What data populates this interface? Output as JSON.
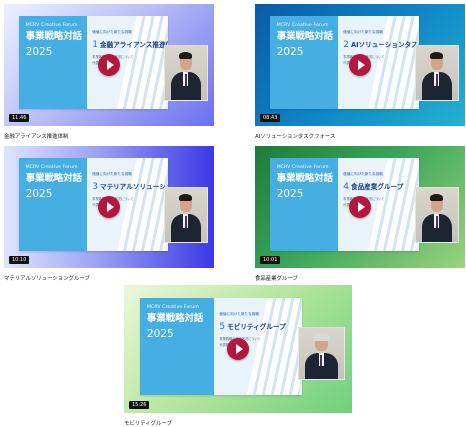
{
  "slide": {
    "forum": "MCRV Creative Forum",
    "title": "事業戦略対話",
    "year": "2025",
    "top_line": "価値に向けた新たな挑戦",
    "sub_line": "事業戦略の進捗状況について",
    "sub_line2": "代表取締役"
  },
  "videos": [
    {
      "number": "1",
      "heading": "金融アライアンス推進体制",
      "duration": "11:46",
      "caption": "金融アライアンス推進体制"
    },
    {
      "number": "2",
      "heading": "AIソリューションタスクフォース",
      "duration": "08:43",
      "caption": "AIソリューションタスクフォース"
    },
    {
      "number": "3",
      "heading": "マテリアルソリューショングループ",
      "duration": "10:10",
      "caption": "マテリアルソリューショングループ"
    },
    {
      "number": "4",
      "heading": "食品産業グループ",
      "duration": "10:01",
      "caption": "食品産業グループ"
    },
    {
      "number": "5",
      "heading": "モビリティグループ",
      "duration": "15:26",
      "caption": "モビリティグループ"
    }
  ],
  "icons": {
    "play": "play-icon"
  },
  "colors": {
    "slide_blue": "#45aee2",
    "play_button": "#b3173e",
    "duration_badge": "#111111"
  }
}
